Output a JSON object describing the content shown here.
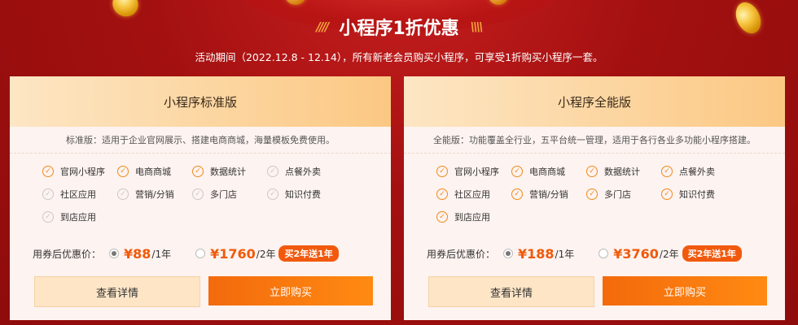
{
  "header": {
    "title": "小程序1折优惠",
    "subtitle": "活动期间（2022.12.8 - 12.14），所有新老会员购买小程序，可享受1折购买小程序一套。",
    "slashes_left": "////",
    "slashes_right": "\\\\\\\\"
  },
  "plans": [
    {
      "name": "小程序标准版",
      "desc": "标准版：适用于企业官网展示、搭建电商商城，海量模板免费使用。",
      "features": [
        {
          "label": "官网小程序",
          "enabled": true
        },
        {
          "label": "电商商城",
          "enabled": true
        },
        {
          "label": "数据统计",
          "enabled": true
        },
        {
          "label": "点餐外卖",
          "enabled": false
        },
        {
          "label": "社区应用",
          "enabled": false
        },
        {
          "label": "营销/分销",
          "enabled": false
        },
        {
          "label": "多门店",
          "enabled": false
        },
        {
          "label": "知识付费",
          "enabled": false
        },
        {
          "label": "到店应用",
          "enabled": false
        }
      ],
      "price_label": "用券后优惠价：",
      "option1": {
        "price": "¥88",
        "unit": "/1年",
        "selected": true
      },
      "option2": {
        "price": "¥1760",
        "unit": "/2年",
        "selected": false,
        "badge": "买2年送1年"
      },
      "detail_btn": "查看详情",
      "buy_btn": "立即购买"
    },
    {
      "name": "小程序全能版",
      "desc": "全能版：功能覆盖全行业，五平台统一管理，适用于各行各业多功能小程序搭建。",
      "features": [
        {
          "label": "官网小程序",
          "enabled": true
        },
        {
          "label": "电商商城",
          "enabled": true
        },
        {
          "label": "数据统计",
          "enabled": true
        },
        {
          "label": "点餐外卖",
          "enabled": true
        },
        {
          "label": "社区应用",
          "enabled": true
        },
        {
          "label": "营销/分销",
          "enabled": true
        },
        {
          "label": "多门店",
          "enabled": true
        },
        {
          "label": "知识付费",
          "enabled": true
        },
        {
          "label": "到店应用",
          "enabled": true
        }
      ],
      "price_label": "用券后优惠价：",
      "option1": {
        "price": "¥188",
        "unit": "/1年",
        "selected": true
      },
      "option2": {
        "price": "¥3760",
        "unit": "/2年",
        "selected": false,
        "badge": "买2年送1年"
      },
      "detail_btn": "查看详情",
      "buy_btn": "立即购买"
    }
  ],
  "colors": {
    "background": "#a31010",
    "accent": "#f36a0c",
    "price": "#f05a0a",
    "check_on": "#f08a1c",
    "check_off": "#c9c9c9"
  }
}
